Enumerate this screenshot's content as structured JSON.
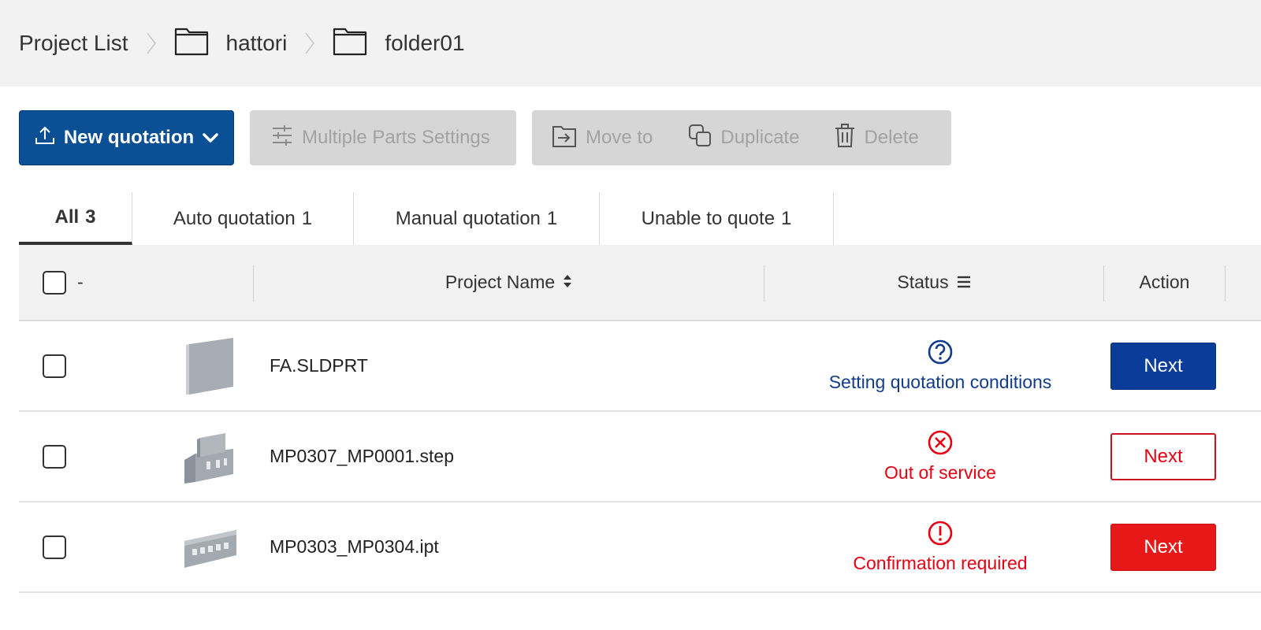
{
  "breadcrumb": {
    "root": "Project List",
    "folders": [
      "hattori",
      "folder01"
    ]
  },
  "toolbar": {
    "new_quotation": "New quotation",
    "multiple_parts": "Multiple Parts Settings",
    "move_to": "Move to",
    "duplicate": "Duplicate",
    "delete": "Delete"
  },
  "tabs": [
    {
      "label": "All",
      "count": "3"
    },
    {
      "label": "Auto quotation",
      "count": "1"
    },
    {
      "label": "Manual quotation",
      "count": "1"
    },
    {
      "label": "Unable to quote",
      "count": "1"
    }
  ],
  "table": {
    "select_all_label": "-",
    "col_project": "Project Name",
    "col_status": "Status",
    "col_action": "Action",
    "rows": [
      {
        "name": "FA.SLDPRT",
        "status": "Setting quotation conditions",
        "status_icon": "question-icon",
        "action": "Next",
        "status_color": "#113c8c"
      },
      {
        "name": "MP0307_MP0001.step",
        "status": "Out of service",
        "status_icon": "x-circle-icon",
        "action": "Next",
        "status_color": "#e60012"
      },
      {
        "name": "MP0303_MP0304.ipt",
        "status": "Confirmation required",
        "status_icon": "exclamation-icon",
        "action": "Next",
        "status_color": "#e60012"
      }
    ]
  },
  "colors": {
    "primary": "#0b4f94",
    "next_blue": "#0a3d99",
    "alert_red": "#e60012"
  }
}
